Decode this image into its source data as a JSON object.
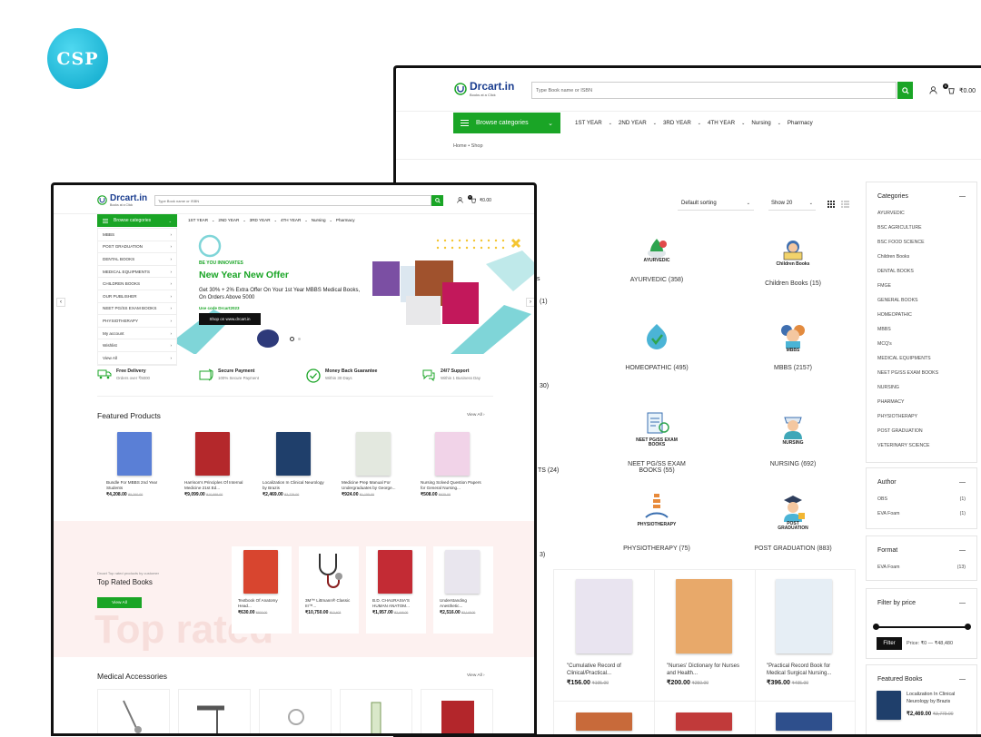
{
  "badge": {
    "text": "CSP"
  },
  "back": {
    "brand": {
      "name": "Drcart.in",
      "tagline": "Books at a Click"
    },
    "search": {
      "placeholder": "Type Book name or ISBN"
    },
    "cart_total": "₹0.00",
    "cart_count": "0",
    "browse_label": "Browse categories",
    "nav": [
      "1ST YEAR",
      "2ND YEAR",
      "3RD YEAR",
      "4TH YEAR",
      "Nursing",
      "Pharmacy"
    ],
    "breadcrumb": {
      "home": "Home",
      "sep": "•",
      "current": "Shop"
    },
    "sorting": "Default sorting",
    "show": "Show 20",
    "partial_labels": [
      "s",
      "(1)",
      "30)",
      "TS (24)",
      "3)"
    ],
    "categories": [
      {
        "icon": "AYURVEDIC",
        "label": "AYURVEDIC",
        "count": "(358)"
      },
      {
        "icon": "Children Books",
        "label": "Children Books",
        "count": "(15)"
      },
      {
        "icon": "",
        "label": "HOMEOPATHIC",
        "count": "(495)"
      },
      {
        "icon": "MBBS",
        "label": "MBBS",
        "count": "(2157)"
      },
      {
        "icon": "NEET PG/SS EXAM BOOKS",
        "label": "NEET PG/SS EXAM BOOKS",
        "count": "(55)"
      },
      {
        "icon": "NURSING",
        "label": "NURSING",
        "count": "(692)"
      },
      {
        "icon": "PHYSIOTHERAPY",
        "label": "PHYSIOTHERAPY",
        "count": "(75)"
      },
      {
        "icon": "POST GRADUATION",
        "label": "POST GRADUATION",
        "count": "(883)"
      }
    ],
    "products": [
      {
        "title": "\"Cumulative Record of Clinical/Practical...",
        "price": "₹156.00",
        "old": "₹195.00",
        "color": "#e9e4f0"
      },
      {
        "title": "\"Nurses' Dictionary for Nurses and Health...",
        "price": "₹200.00",
        "old": "₹250.00",
        "color": "#e8a96a"
      },
      {
        "title": "\"Practical Record Book for Medical Surgical Nursing...",
        "price": "₹396.00",
        "old": "₹495.00",
        "color": "#e6eef5"
      }
    ],
    "sidebar": {
      "categories_title": "Categories",
      "categories": [
        "AYURVEDIC",
        "BSC AGRICULTURE",
        "BSC FOOD SCIENCE",
        "Children Books",
        "DENTAL BOOKS",
        "FMGE",
        "GENERAL BOOKS",
        "HOMEOPATHIC",
        "MBBS",
        "MCQ's",
        "MEDICAL EQUIPMENTS",
        "NEET PG/SS EXAM BOOKS",
        "NURSING",
        "PHARMACY",
        "PHYSIOTHERAPY",
        "POST GRADUATION",
        "VETERINARY SCIENCE"
      ],
      "author_title": "Author",
      "authors": [
        {
          "name": "OBS",
          "count": "(1)"
        },
        {
          "name": "EVA Foam",
          "count": "(1)"
        }
      ],
      "format_title": "Format",
      "formats": [
        {
          "name": "EVA Foam",
          "count": "(13)"
        }
      ],
      "price_title": "Filter by price",
      "filter_btn": "Filter",
      "price_range": "Price: ₹0 — ₹48,480",
      "featured_title": "Featured Books",
      "featured": {
        "title": "Localization In Clinical Neurology by Brazis",
        "price": "₹2,469.00",
        "old": "₹3,779.00"
      }
    }
  },
  "front": {
    "brand": {
      "name": "Drcart.in",
      "tagline": "Books at a Click"
    },
    "search": {
      "placeholder": "Type Book name or ISBN"
    },
    "cart_total": "₹0.00",
    "cart_count": "0",
    "browse_label": "Browse categories",
    "nav": [
      "1ST YEAR",
      "2ND YEAR",
      "3RD YEAR",
      "4TH YEAR",
      "Nursing",
      "Pharmacy"
    ],
    "menu": [
      "MBBS",
      "POST GRADUATION",
      "DENTAL BOOKS",
      "MEDICAL EQUIPMENTS",
      "CHILDREN BOOKS",
      "OUR PUBLISHER",
      "NEET PG/SS EXAM BOOKS",
      "PHYSIOTHERAPY",
      "My account",
      "Wishlist",
      "View All"
    ],
    "hero": {
      "kicker": "BE YOU INNOVATES",
      "title": "New Year New Offer",
      "text": "Get 30% + 2% Extra Offer On Your 1st Year MBBS Medical Books, On Orders Above 5000",
      "code": "Use code Drcart2023",
      "cta": "Shop on www.drcart.in"
    },
    "features": [
      {
        "icon": "delivery-truck-icon",
        "title": "Free Delivery",
        "sub": "Orders over ₹5000"
      },
      {
        "icon": "secure-payment-icon",
        "title": "Secure Payment",
        "sub": "100% Secure Payment"
      },
      {
        "icon": "money-back-icon",
        "title": "Money Back Guarantee",
        "sub": "Within 30 Days"
      },
      {
        "icon": "support-icon",
        "title": "24/7 Support",
        "sub": "Within 1 Business Day"
      }
    ],
    "featured_title": "Featured Products",
    "view_all": "View All",
    "featured": [
      {
        "title": "Bundle For MBBS 2nd Year Students",
        "price": "₹4,208.00",
        "old": "₹5,260.00",
        "color": "#5a7fd6"
      },
      {
        "title": "Harrison's Principles Of Internal Medicine 21st Ed...",
        "price": "₹9,099.00",
        "old": "₹10,999.00",
        "color": "#b4282b"
      },
      {
        "title": "Localization In Clinical Neurology by Brazis",
        "price": "₹2,469.00",
        "old": "₹3,779.00",
        "color": "#1f3f6b"
      },
      {
        "title": "Medicine Prep Manual For Undergraduates by George...",
        "price": "₹924.00",
        "old": "₹1,155.00",
        "color": "#e3e8df"
      },
      {
        "title": "Nursing Solved Question Papers for General Nursing...",
        "price": "₹508.00",
        "old": "₹635.00",
        "color": "#f1d3e8"
      }
    ],
    "top_rated": {
      "kicker": "Drcart Top rated products by customer",
      "title": "Top Rated Books",
      "btn": "View All",
      "bg_text": "Top rated",
      "items": [
        {
          "title": "Textbook Of Anatomy Head...",
          "price": "₹630.00",
          "old": "₹800.00",
          "color": "#d8452f"
        },
        {
          "title": "3M™ Littmann® Classic III™...",
          "price": "₹10,750.00",
          "old": "₹13,403",
          "color": "#fafafa"
        },
        {
          "title": "B.D. CHAURASIA'S HUMAN ANATOM...",
          "price": "₹1,957.00",
          "old": "₹2,446.00",
          "color": "#c32b34"
        },
        {
          "title": "Understanding Anesthetic...",
          "price": "₹2,516.00",
          "old": "₹3,145.00",
          "color": "#e9e6ee"
        }
      ]
    },
    "accessories_title": "Medical Accessories"
  }
}
